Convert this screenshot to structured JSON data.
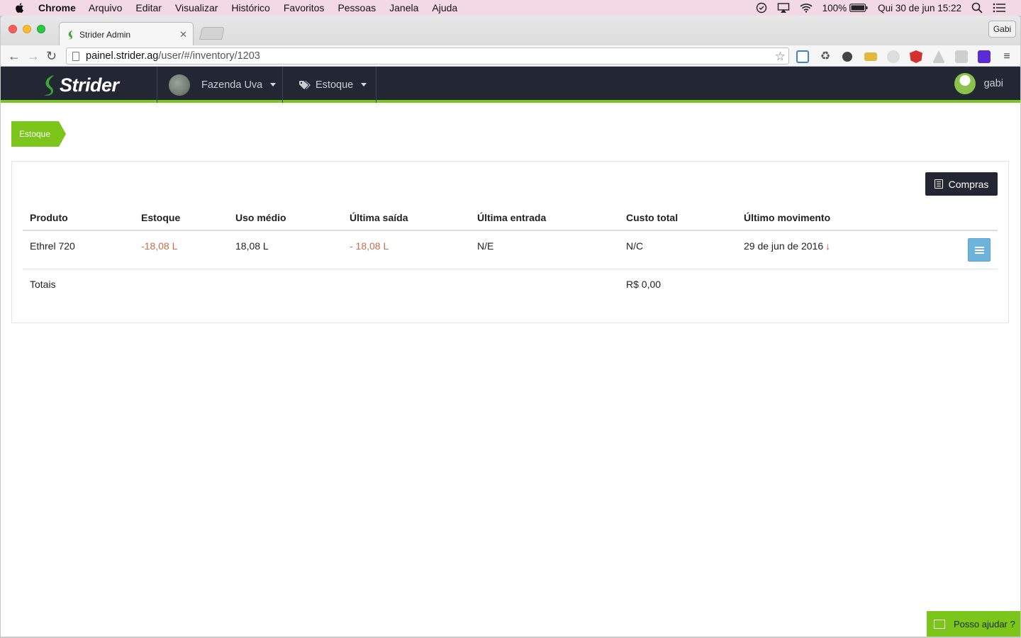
{
  "os_menubar": {
    "app_name": "Chrome",
    "menus": [
      "Arquivo",
      "Editar",
      "Visualizar",
      "Histórico",
      "Favoritos",
      "Pessoas",
      "Janela",
      "Ajuda"
    ],
    "battery": "100%",
    "clock": "Qui 30 de jun  15:22"
  },
  "browser": {
    "tab_title": "Strider Admin",
    "profile_name": "Gabi",
    "url_host": "painel.strider.ag",
    "url_path": "/user/#/inventory/1203"
  },
  "app": {
    "brand": "Strider",
    "farm_selector": "Fazenda Uva",
    "menu_estoque": "Estoque",
    "user_name": "gabi",
    "brand_color": "#7cc51b"
  },
  "breadcrumb": {
    "current": "Estoque"
  },
  "panel": {
    "compras_label": "Compras",
    "columns": [
      "Produto",
      "Estoque",
      "Uso médio",
      "Última saída",
      "Última entrada",
      "Custo total",
      "Último movimento"
    ],
    "rows": [
      {
        "produto": "Ethrel 720",
        "estoque": "-18,08 L",
        "uso_medio": "18,08 L",
        "ultima_saida": "- 18,08 L",
        "ultima_entrada": "N/E",
        "custo_total": "N/C",
        "ultimo_movimento": "29 de jun de 2016"
      }
    ],
    "totals": {
      "label": "Totais",
      "custo_total": "R$ 0,00"
    }
  },
  "help_widget": {
    "label": "Posso ajudar ?"
  }
}
